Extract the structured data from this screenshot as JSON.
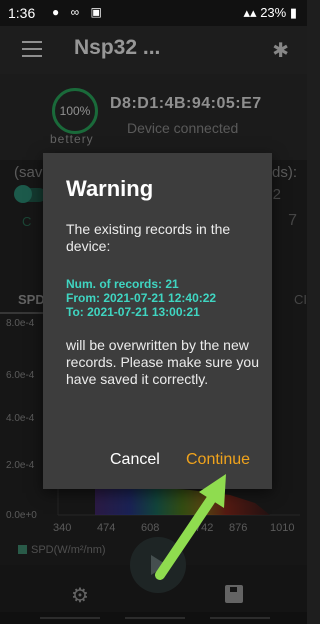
{
  "status_bar": {
    "time": "1:36",
    "icons": "● ∞ ▣",
    "battery": "23%"
  },
  "app_bar": {
    "title": "Nsp32 ..."
  },
  "device": {
    "battery_value": "100%",
    "battery_label": "bettery",
    "mac_address": "D8:D1:4B:94:05:E7",
    "status": "Device connected"
  },
  "background": {
    "saved_label_fragment": "(sav",
    "records_label_fragment": "ds):",
    "records_value_fragment": "2",
    "value_fragment": "7",
    "green_fragment": "C",
    "tab_spd": "SPD",
    "tab_ci_fragment": "CI",
    "chart": {
      "type": "area",
      "y_ticks": [
        "8.0e-4",
        "6.0e-4",
        "4.0e-4",
        "2.0e-4",
        "0.0e+0"
      ],
      "x_ticks": [
        "340",
        "474",
        "608",
        "742",
        "876",
        "1010"
      ],
      "legend": "SPD(W/m²/nm)"
    }
  },
  "dialog": {
    "title": "Warning",
    "message_intro": "The existing records in the device:",
    "num_records": "Num. of records: 21",
    "from": "From: 2021-07-21 12:40:22",
    "to": "To: 2021-07-21 13:00:21",
    "message_outro": "will be overwritten by the new records. Please make sure you have saved it correctly.",
    "cancel_label": "Cancel",
    "continue_label": "Continue"
  },
  "colors": {
    "accent_orange": "#f0a31c",
    "info_cyan": "#3fd6c2",
    "battery_ring": "#29a35a",
    "annotation_arrow": "#8fdc4f"
  }
}
